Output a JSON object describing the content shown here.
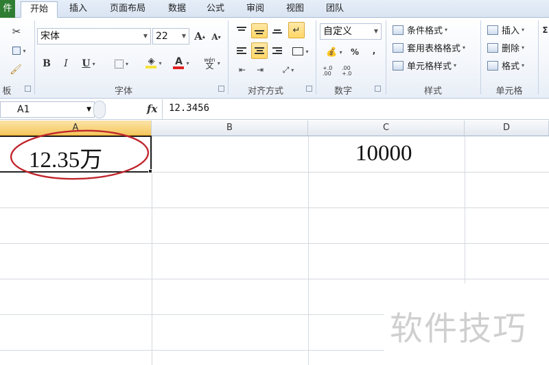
{
  "tabs": [
    {
      "label": "件"
    },
    {
      "label": "开始"
    },
    {
      "label": "插入"
    },
    {
      "label": "页面布局"
    },
    {
      "label": "数据"
    },
    {
      "label": "公式"
    },
    {
      "label": "审阅"
    },
    {
      "label": "视图"
    },
    {
      "label": "团队"
    }
  ],
  "ribbon": {
    "clipboard": {
      "label": "板"
    },
    "font": {
      "label": "字体",
      "name": "宋体",
      "size": "22",
      "bold": "B",
      "italic": "I",
      "underline": "U",
      "grow": "A",
      "shrink": "A",
      "color_letter": "A",
      "phonetic": "wén"
    },
    "alignment": {
      "label": "对齐方式"
    },
    "number": {
      "label": "数字",
      "format": "自定义",
      "percent": "%",
      "comma": ",",
      "dec_inc": "+.0 .00",
      "dec_dec": ".00 +.0"
    },
    "styles": {
      "label": "样式",
      "conditional": "条件格式",
      "table_format": "套用表格格式",
      "cell_styles": "单元格样式"
    },
    "cells": {
      "label": "单元格",
      "insert": "插入",
      "delete": "删除",
      "format": "格式"
    },
    "editing": {
      "sigma": "Σ"
    }
  },
  "formula_bar": {
    "name_box": "A1",
    "fx": "fx",
    "content": "12.3456"
  },
  "columns": [
    {
      "label": "A"
    },
    {
      "label": "B"
    },
    {
      "label": "C"
    },
    {
      "label": "D"
    }
  ],
  "cells": {
    "a1": "12.35万",
    "c1": "10000"
  },
  "watermark": "软件技巧",
  "colors": {
    "annotation": "#c0262d",
    "active_header": "#f5c75e",
    "file_tab": "#2f7d32"
  }
}
